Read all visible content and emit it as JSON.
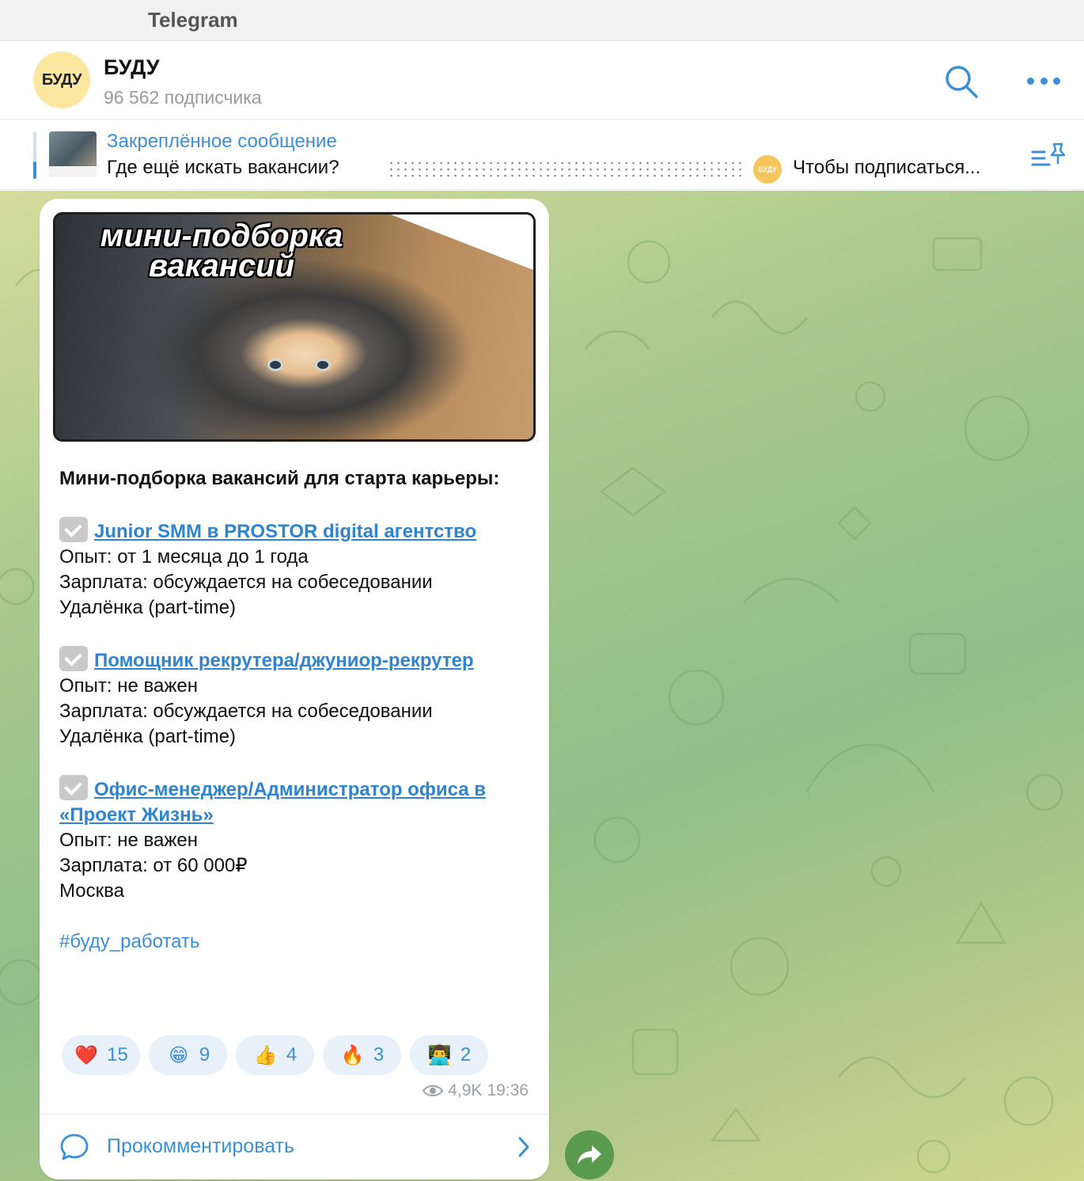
{
  "window": {
    "title": "Telegram"
  },
  "header": {
    "avatar_text": "БУДУ",
    "channel_name": "БУДУ",
    "subscribers": "96 562 подписчика"
  },
  "pinned": {
    "title": "Закреплённое сообщение",
    "text": "Где ещё искать вакансии?",
    "mini_avatar_text": "БУДУ",
    "tail": "Чтобы подписаться..."
  },
  "post": {
    "image_caption_line1": "мини-подборка",
    "image_caption_line2": "вакансий",
    "intro": "Мини-подборка вакансий для старта карьеры:",
    "jobs": [
      {
        "title": "Junior SMM в PROSTOR digital агентство",
        "experience": "Опыт: от 1 месяца до 1 года",
        "salary": "Зарплата: обсуждается на собеседовании",
        "format": "Удалёнка (part-time)"
      },
      {
        "title": "Помощник рекрутера/джуниор-рекрутер",
        "experience": "Опыт: не важен",
        "salary": "Зарплата: обсуждается на собеседовании",
        "format": "Удалёнка (part-time)"
      },
      {
        "title": "Офис-менеджер/Администратор офиса в «Проект Жизнь»",
        "experience": "Опыт: не важен",
        "salary": "Зарплата: от 60 000₽",
        "format": "Москва"
      }
    ],
    "hashtag": "#буду_работать",
    "reactions": [
      {
        "emoji": "❤️",
        "count": "15"
      },
      {
        "emoji": "😁",
        "count": "9"
      },
      {
        "emoji": "👍",
        "count": "4"
      },
      {
        "emoji": "🔥",
        "count": "3"
      },
      {
        "emoji": "👨‍💻",
        "count": "2"
      }
    ],
    "views": "4,9K",
    "time": "19:36",
    "comment_label": "Прокомментировать"
  },
  "icons": {
    "search": "search-icon",
    "more": "more-icon",
    "pinned_list": "pinned-list-icon",
    "comment": "comment-icon",
    "forward": "forward-icon",
    "eye": "eye-icon"
  },
  "colors": {
    "accent": "#3b8fd6",
    "link": "#2f83cf",
    "reaction_bg": "#e8f1fa",
    "forward_bg": "#5a9a4e"
  }
}
